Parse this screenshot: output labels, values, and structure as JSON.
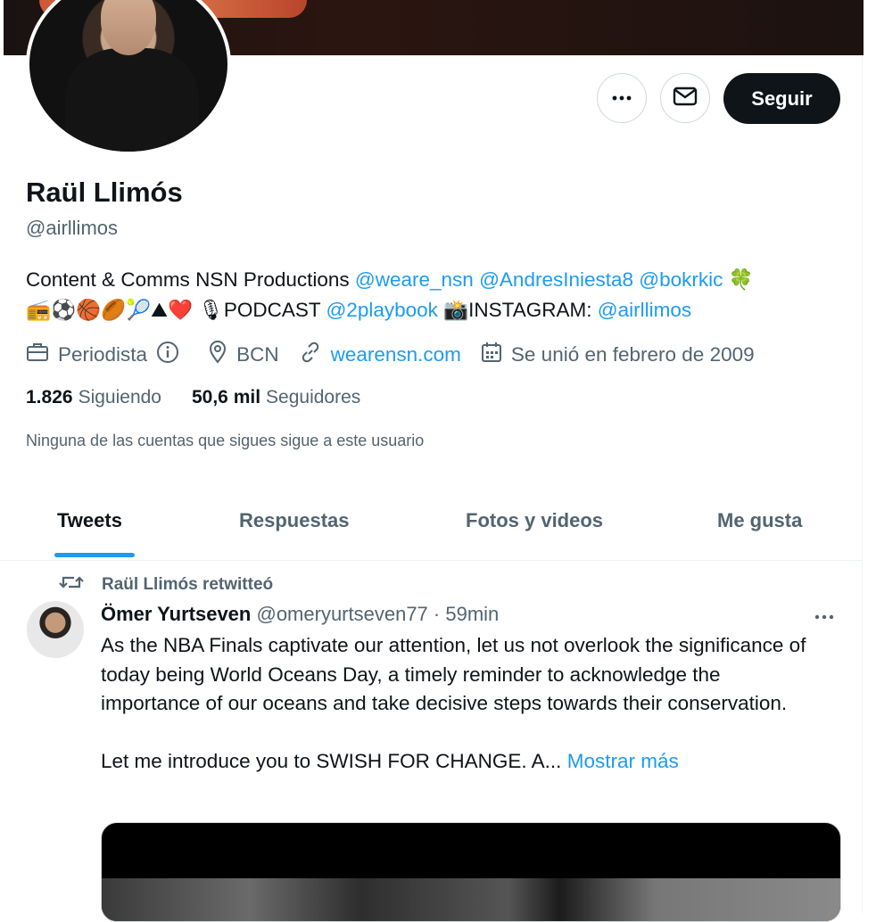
{
  "profile": {
    "name": "Raül Llimós",
    "handle": "@airllimos",
    "follow_label": "Seguir",
    "more_label": "···",
    "bio": {
      "line1_text": "Content & Comms NSN Productions ",
      "line1_links": [
        "@weare_nsn",
        "@AndresIniesta8",
        "@bokrkic"
      ],
      "line1_emoji": "🍀",
      "line2_emojis": "📻⚽🏀🏉🎾⛰❤️",
      "line2_mic": "🎙",
      "line2_podcast": "PODCAST",
      "line2_link1": "@2playbook",
      "line2_camera": "📸",
      "line2_instagram": "INSTAGRAM:",
      "line2_link2": "@airllimos"
    },
    "meta": {
      "category": "Periodista",
      "location": "BCN",
      "website": "wearensn.com",
      "joined": "Se unió en febrero de 2009"
    },
    "stats": {
      "following_count": "1.826",
      "following_label": "Siguiendo",
      "followers_count": "50,6 mil",
      "followers_label": "Seguidores"
    },
    "mutuals_note": "Ninguna de las cuentas que sigues sigue a este usuario"
  },
  "tabs": [
    {
      "label": "Tweets",
      "active": true
    },
    {
      "label": "Respuestas",
      "active": false
    },
    {
      "label": "Fotos y videos",
      "active": false
    },
    {
      "label": "Me gusta",
      "active": false
    }
  ],
  "tweet": {
    "retweet_note": "Raül Llimós retwitteó",
    "author_name": "Ömer Yurtseven",
    "author_handle_time": "@omeryurtseven77 · 59min",
    "more_label": "···",
    "paragraph1": "As the NBA Finals captivate our attention, let us not overlook the significance of today being World Oceans Day, a timely reminder to acknowledge the importance of our oceans and take decisive steps towards their conservation.",
    "paragraph2": "Let me introduce you to SWISH FOR CHANGE. A...",
    "show_more": "Mostrar más"
  },
  "colors": {
    "accent": "#1d9bf0",
    "text_primary": "#0f1419",
    "text_secondary": "#536471",
    "button_dark": "#0f1419"
  },
  "icons": [
    "more-dots-icon",
    "envelope-icon",
    "briefcase-icon",
    "info-icon",
    "location-pin-icon",
    "link-icon",
    "calendar-icon",
    "retweet-icon"
  ]
}
